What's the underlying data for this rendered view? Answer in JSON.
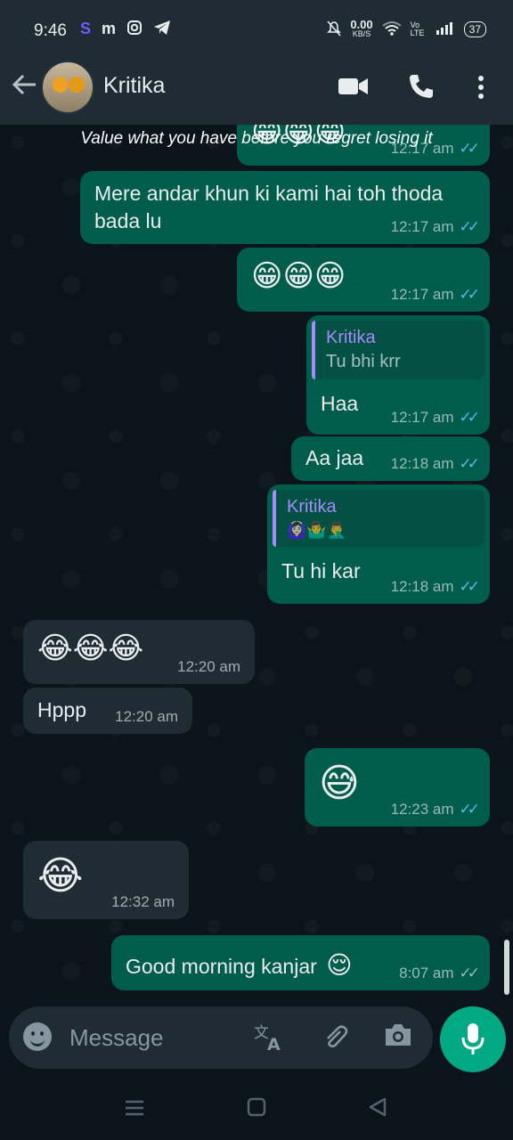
{
  "status_bar": {
    "time": "9:46",
    "left_icons": [
      "s-app-icon",
      "m-app-icon",
      "instagram-icon",
      "telegram-icon"
    ],
    "speed": "0.00",
    "speed_unit": "KB/S",
    "network": "Vo LTE",
    "battery": "37"
  },
  "header": {
    "contact_name": "Kritika",
    "icons": [
      "back-arrow-icon",
      "video-call-icon",
      "voice-call-icon",
      "more-options-icon"
    ]
  },
  "chat": {
    "caption_overlay": "Value what you have before you regret losing it",
    "messages": [
      {
        "dir": "out",
        "emoji": "😁😁😁",
        "time": "12:17 am",
        "read": true,
        "partial": true
      },
      {
        "dir": "out",
        "text": "Mere andar khun ki kami hai toh thoda bada lu",
        "time": "12:17 am",
        "read": true
      },
      {
        "dir": "out",
        "emoji": "😁😁😁",
        "time": "12:17 am",
        "read": true
      },
      {
        "dir": "out",
        "quote_name": "Kritika",
        "quote_text": "Tu bhi krr",
        "text": "Haa",
        "time": "12:17 am",
        "read": true
      },
      {
        "dir": "out",
        "text": "Aa jaa",
        "time": "12:18 am",
        "read": true
      },
      {
        "dir": "out",
        "quote_name": "Kritika",
        "quote_text": "🙆🏻‍♀️🤷‍♂️🤦‍♂️",
        "text": "Tu hi kar",
        "time": "12:18 am",
        "read": true
      },
      {
        "dir": "in",
        "emoji": "😂😂😂",
        "time": "12:20 am"
      },
      {
        "dir": "in",
        "text": "Hppp",
        "time": "12:20 am"
      },
      {
        "dir": "out",
        "emoji": "😅",
        "time": "12:23 am",
        "read": true
      },
      {
        "dir": "in",
        "emoji": "😂",
        "time": "12:32 am"
      },
      {
        "dir": "out",
        "text": "Good morning kanjar",
        "emoji": "😌",
        "time": "8:07 am",
        "read": false
      }
    ]
  },
  "input": {
    "placeholder": "Message",
    "icons": [
      "emoji-icon",
      "translate-icon",
      "attach-icon",
      "camera-icon",
      "mic-icon"
    ]
  },
  "colors": {
    "outgoing_bubble": "#005c4b",
    "incoming_bubble": "#1f2c34",
    "read_ticks": "#53bdeb",
    "accent": "#00a884"
  }
}
